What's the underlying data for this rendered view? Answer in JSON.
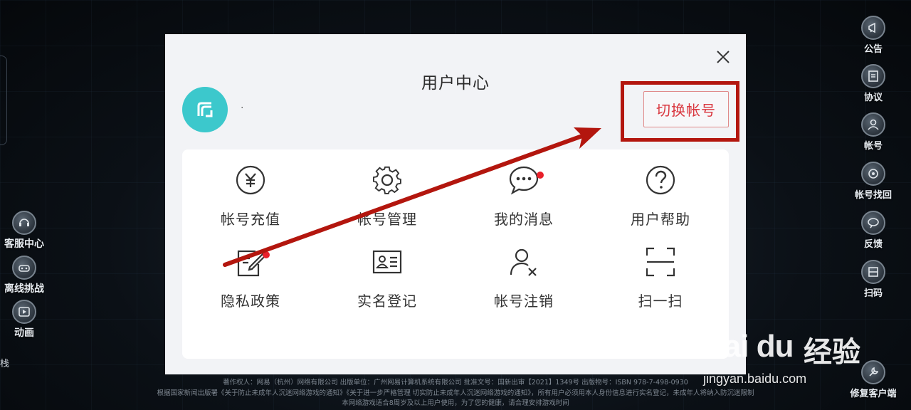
{
  "dialog": {
    "title": "用户中心",
    "username": "·",
    "switch_account_label": "切换帐号",
    "tiles": [
      {
        "label": "帐号充值",
        "icon": "yen-circle-icon"
      },
      {
        "label": "帐号管理",
        "icon": "gear-icon"
      },
      {
        "label": "我的消息",
        "icon": "chat-bubble-icon",
        "badge": true
      },
      {
        "label": "用户帮助",
        "icon": "question-circle-icon"
      },
      {
        "label": "隐私政策",
        "icon": "privacy-edit-icon",
        "badge": true
      },
      {
        "label": "实名登记",
        "icon": "id-card-icon"
      },
      {
        "label": "帐号注销",
        "icon": "user-remove-icon"
      },
      {
        "label": "扫一扫",
        "icon": "scan-icon"
      }
    ]
  },
  "right_sidebar": [
    {
      "label": "公告",
      "icon": "announcement-icon"
    },
    {
      "label": "协议",
      "icon": "agreement-icon"
    },
    {
      "label": "帐号",
      "icon": "account-icon"
    },
    {
      "label": "帐号找回",
      "icon": "account-recovery-icon"
    },
    {
      "label": "反馈",
      "icon": "feedback-icon"
    },
    {
      "label": "扫码",
      "icon": "scan-code-icon"
    },
    {
      "label": "修复客户端",
      "icon": "repair-client-icon"
    }
  ],
  "left_sidebar": [
    {
      "label": "客服中心",
      "icon": "customer-service-icon"
    },
    {
      "label": "离线挑战",
      "icon": "offline-challenge-icon"
    },
    {
      "label": "动画",
      "icon": "animation-icon"
    }
  ],
  "left_edge_text": "栈",
  "footer": {
    "line1": "著作权人：网易（杭州）网络有限公司 出版单位：广州网易计算机系统有限公司 批准文号：国新出审【2021】1349号 出版物号：ISBN 978-7-498-0930",
    "line2": "根据国家新闻出版署《关于防止未成年人沉迷网络游戏的通知》《关于进一步严格管理 切实防止未成年人沉迷网络游戏的通知》，所有用户必须用本人身份信息进行实名登记，未成年人将纳入防沉迷限制",
    "line3": "本网络游戏适合8周岁及以上用户使用，为了您的健康，请合理安排游戏时间"
  },
  "watermark": {
    "logo": "Bai du",
    "logo_cn": "经验",
    "site": "jingyan.baidu.com"
  },
  "colors": {
    "accent_red": "#d9363e",
    "annotation_red": "#b3160e",
    "avatar_teal": "#3cc8cc",
    "badge_red": "#e8202a"
  }
}
